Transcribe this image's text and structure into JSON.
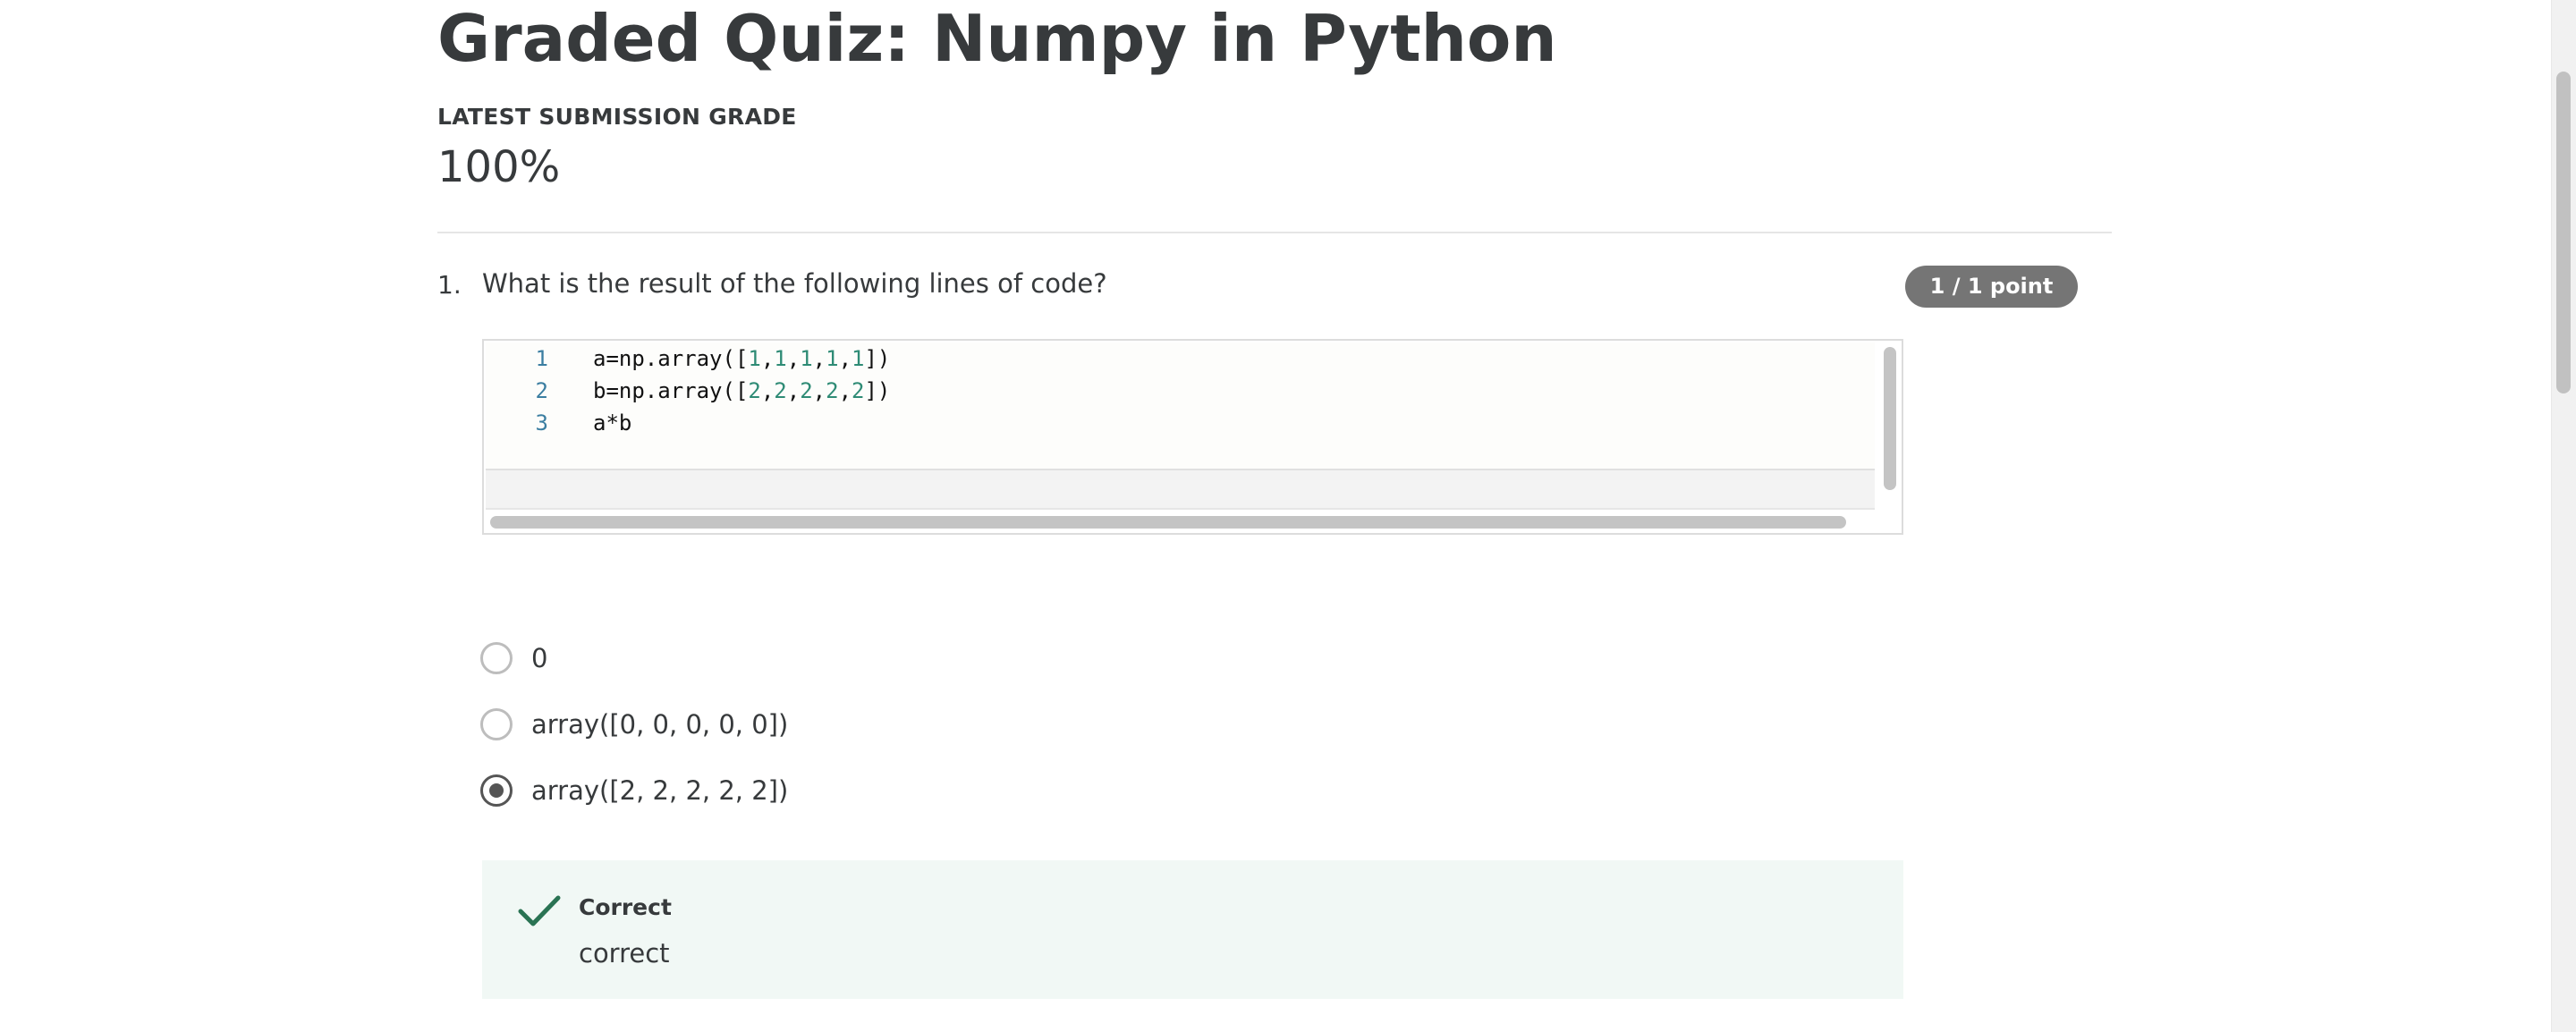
{
  "quiz": {
    "title": "Graded Quiz: Numpy in Python",
    "grade_label": "LATEST SUBMISSION GRADE",
    "grade_value": "100%"
  },
  "question": {
    "number": "1.",
    "text": "What is the result of the following lines of code?",
    "points": "1 / 1 point",
    "code_lines": [
      {
        "line": "1",
        "prefix": "a=np.array([",
        "nums": [
          "1",
          "1",
          "1",
          "1",
          "1"
        ],
        "suffix": "])"
      },
      {
        "line": "2",
        "prefix": "b=np.array([",
        "nums": [
          "2",
          "2",
          "2",
          "2",
          "2"
        ],
        "suffix": "])"
      },
      {
        "line": "3",
        "text": "a*b"
      }
    ],
    "options": [
      {
        "label": "0",
        "selected": false
      },
      {
        "label": "array([0, 0, 0, 0, 0])",
        "selected": false
      },
      {
        "label": "array([2, 2, 2, 2, 2])",
        "selected": true
      }
    ],
    "feedback": {
      "title": "Correct",
      "text": "correct",
      "icon": "checkmark-icon"
    }
  },
  "colors": {
    "badge_bg": "#757575",
    "feedback_bg": "#f1f8f5",
    "check_color": "#2a7353",
    "line_number": "#3b7ea1",
    "code_number": "#2e8b75"
  }
}
